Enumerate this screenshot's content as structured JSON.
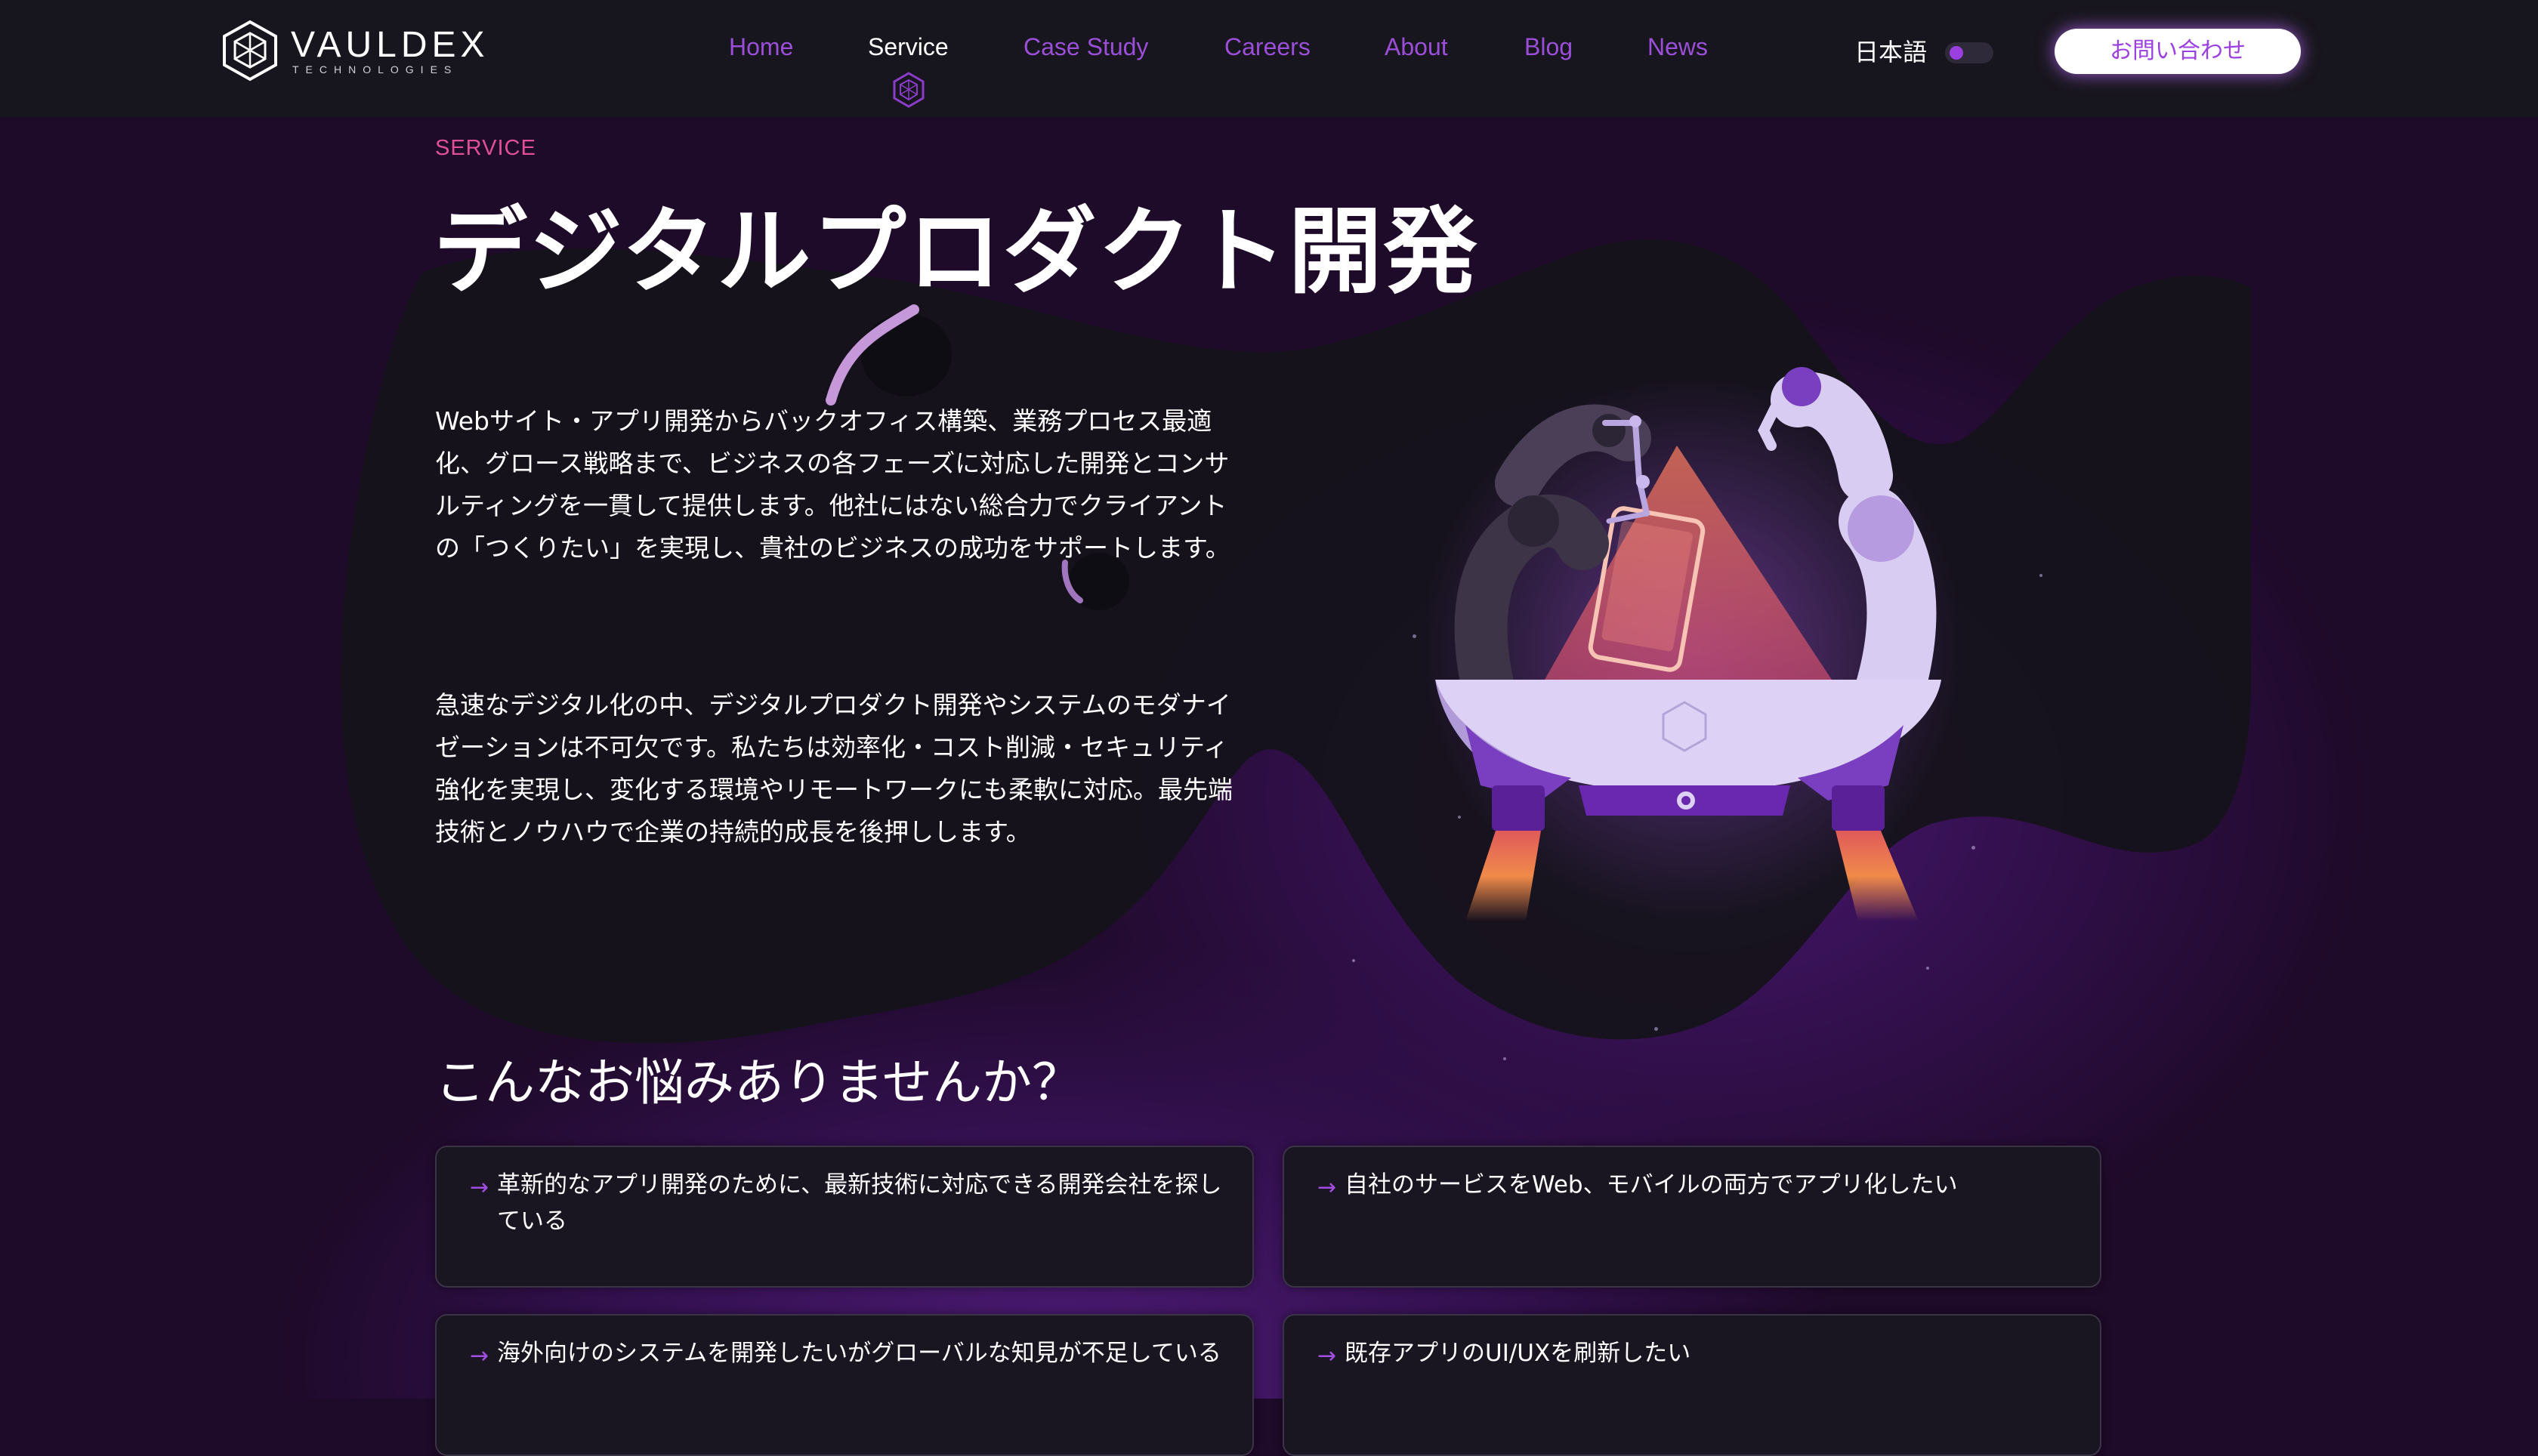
{
  "brand": {
    "name": "VAULDEX",
    "tagline": "TECHNOLOGIES",
    "logo_icon": "hexagon-cube-icon"
  },
  "nav": {
    "items": [
      {
        "label": "Home",
        "active": false
      },
      {
        "label": "Service",
        "active": true
      },
      {
        "label": "Case Study",
        "active": false
      },
      {
        "label": "Careers",
        "active": false
      },
      {
        "label": "About",
        "active": false
      },
      {
        "label": "Blog",
        "active": false
      },
      {
        "label": "News",
        "active": false
      }
    ],
    "language": "日本語",
    "contact_label": "お問い合わせ"
  },
  "hero": {
    "eyebrow": "SERVICE",
    "title": "デジタルプロダクト開発",
    "paragraph1": "Webサイト・アプリ開発からバックオフィス構築、業務プロセス最適化、グロース戦略まで、ビジネスの各フェーズに対応した開発とコンサルティングを一貫して提供します。他社にはない総合力でクライアントの「つくりたい」を実現し、貴社のビジネスの成功をサポートします。",
    "paragraph2": "急速なデジタル化の中、デジタルプロダクト開発やシステムのモダナイゼーションは不可欠です。私たちは効率化・コスト削減・セキュリティ強化を実現し、変化する環境やリモートワークにも柔軟に対応。最先端技術とノウハウで企業の持続的成長を後押しします。"
  },
  "worries": {
    "title": "こんなお悩みありませんか？",
    "arrow_icon": "arrow-right-icon",
    "items": [
      "革新的なアプリ開発のために、最新技術に対応できる開発会社を探している",
      "自社のサービスをWeb、モバイルの両方でアプリ化したい",
      "海外向けのシステムを開発したいがグローバルな知見が不足している",
      "既存アプリのUI/UXを刷新したい"
    ]
  },
  "colors": {
    "accent": "#9b3fe0",
    "eyebrow": "#e0509a",
    "header_bg": "#17151d",
    "page_bg": "#1e0a29"
  }
}
